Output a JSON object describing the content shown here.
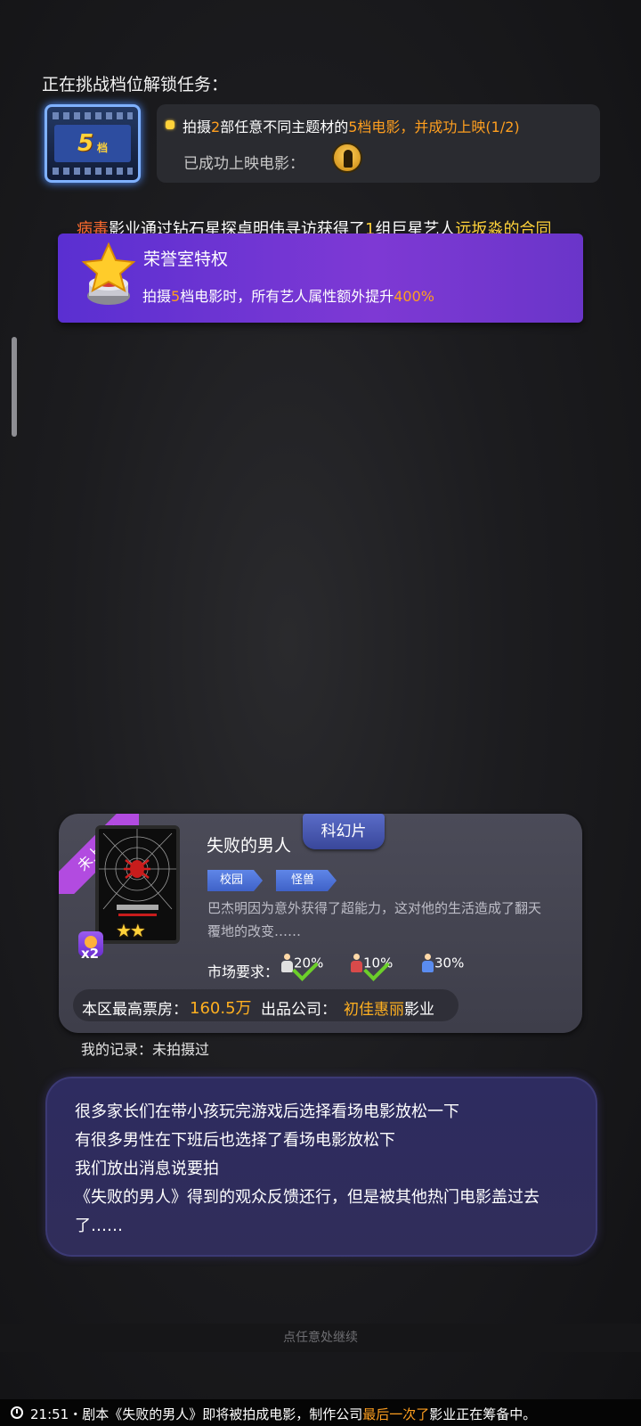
{
  "task": {
    "title": "正在挑战档位解锁任务：",
    "badge_num": "5",
    "badge_unit": "档",
    "line_a": "拍摄",
    "line_b": "2",
    "line_c": "部任意不同主题材的",
    "line_d": "5",
    "line_e": "档电影，并成功上映(1/2)",
    "released_label": "已成功上映电影："
  },
  "news": {
    "p1": "病毒",
    "p2": "影业通过钻石星探卓明伟寻访获得了",
    "p3": "1",
    "p4": "组巨星艺人",
    "p5": "远坂淼的合同"
  },
  "honor": {
    "title": "荣誉室特权",
    "d1": "拍摄",
    "d2": "5",
    "d3": "档电影时，所有艺人属性额外提升",
    "d4": "400%"
  },
  "movie": {
    "ribbon": "未上映过",
    "title": "失败的男人",
    "genre": "科幻片",
    "tags": [
      "校园",
      "怪兽"
    ],
    "description": "巴杰明因为意外获得了超能力，这对他的生活造成了翻天覆地的改变……",
    "stars": "★★",
    "multiplier": "x2",
    "market_label": "市场要求：",
    "market": [
      "20%",
      "10%",
      "30%"
    ],
    "box_office_label": "本区最高票房：",
    "box_office_value": "160.5万",
    "producer_label": "出品公司：",
    "producer_value": "初佳惠丽",
    "producer_suffix": "影业"
  },
  "record": "我的记录：未拍摄过",
  "dialog": {
    "lines": [
      "很多家长们在带小孩玩完游戏后选择看场电影放松一下",
      "有很多男性在下班后也选择了看场电影放松下",
      "我们放出消息说要拍",
      "《失败的男人》得到的观众反馈还行，但是被其他热门电影盖过去了……"
    ]
  },
  "continue": "点任意处继续",
  "ticker": {
    "a": "21:51・剧本《失败的男人》即将被拍成电影，制作公司",
    "b": "最后一次了",
    "c": "影业正在筹备中。"
  },
  "colors": {
    "accent_orange": "#ff9f1f",
    "accent_yellow": "#ffd23a",
    "honor_purple": "#6a35c9",
    "dialog_bg": "#2e2c60"
  }
}
